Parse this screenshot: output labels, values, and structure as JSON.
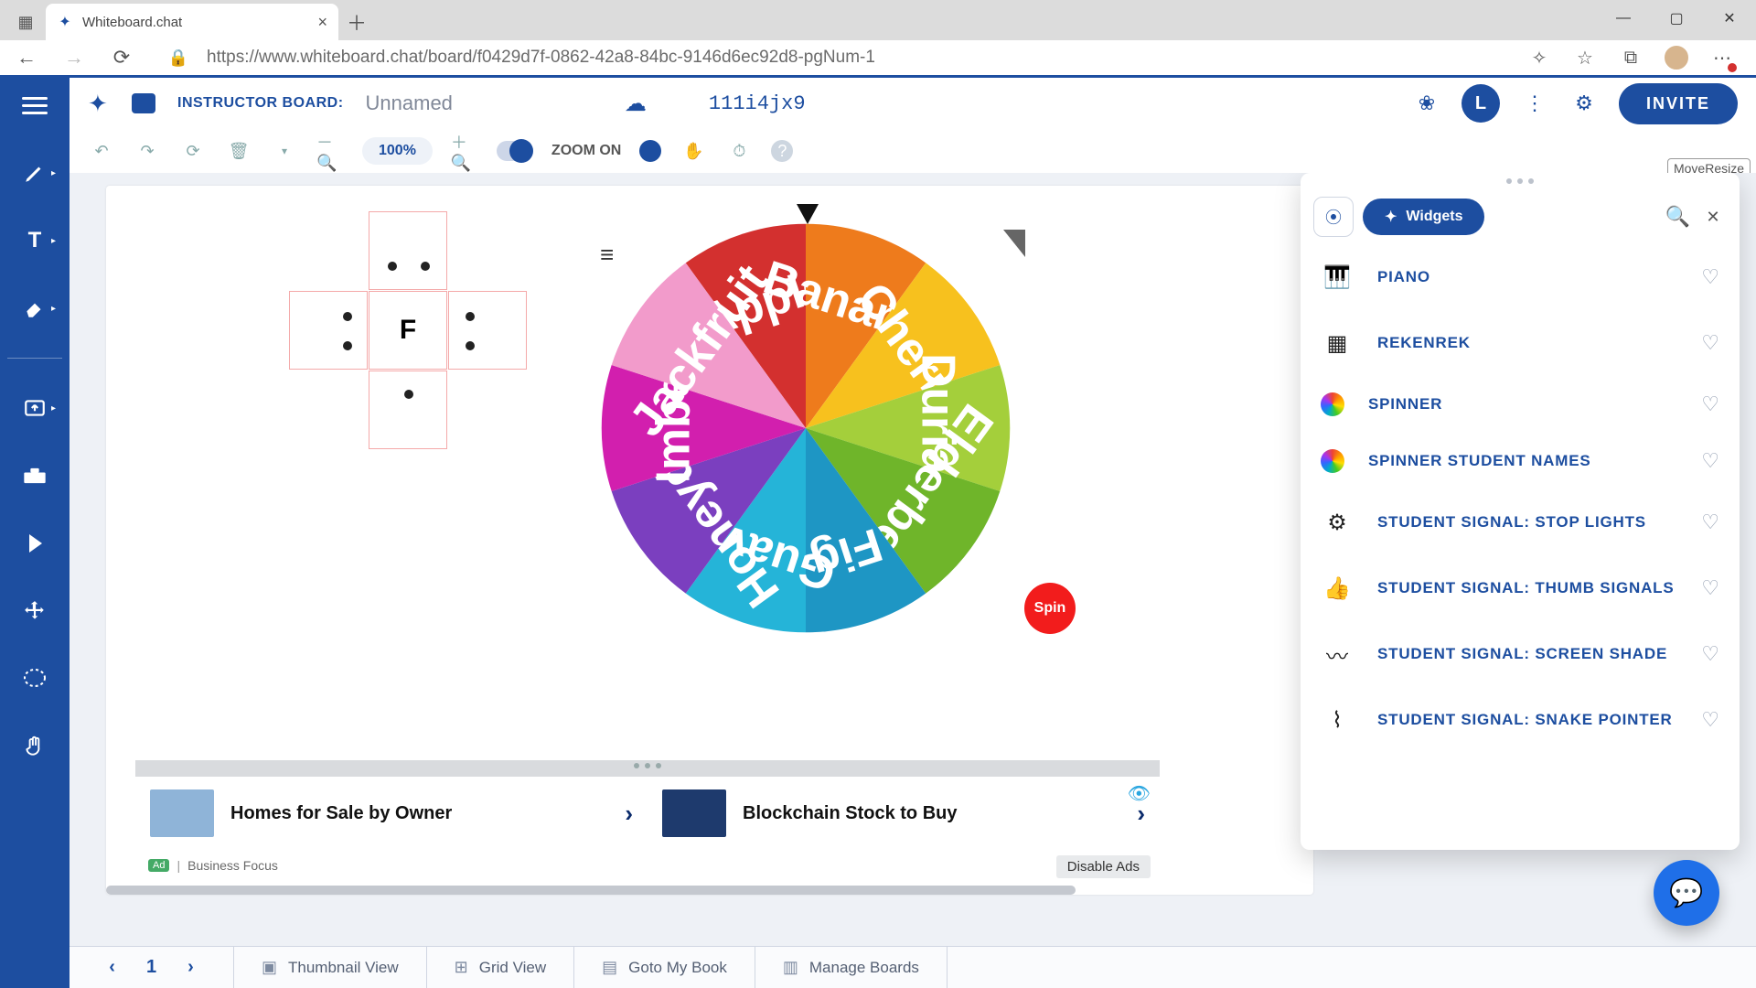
{
  "browser": {
    "tab_title": "Whiteboard.chat",
    "url": "https://www.whiteboard.chat/board/f0429d7f-0862-42a8-84bc-9146d6ec92d8-pgNum-1"
  },
  "header": {
    "board_label": "INSTRUCTOR BOARD:",
    "board_name": "Unnamed",
    "join_code": "111i4jx9",
    "avatar_initial": "L",
    "invite_label": "INVITE"
  },
  "toolbar": {
    "zoom_value": "100%",
    "zoom_toggle_label": "ZOOM ON",
    "move_resize_label": "MoveResize"
  },
  "sidebar_tools": [
    "pen",
    "text",
    "eraser",
    "upload",
    "toolbox",
    "play",
    "move",
    "lasso",
    "gesture"
  ],
  "spinner": {
    "segments": [
      {
        "label": "Apple",
        "color": "#d3302f"
      },
      {
        "label": "Banana",
        "color": "#ee7b1c"
      },
      {
        "label": "Cherry",
        "color": "#f7c11e"
      },
      {
        "label": "Durian",
        "color": "#a4cf3b"
      },
      {
        "label": "Elderberry",
        "color": "#6fb52a"
      },
      {
        "label": "Fig",
        "color": "#1e96c4"
      },
      {
        "label": "Guava",
        "color": "#25b4d8"
      },
      {
        "label": "Honeydew",
        "color": "#7b3fbf"
      },
      {
        "label": "Imbe",
        "color": "#d21fae"
      },
      {
        "label": "Jackfruit",
        "color": "#f29bcb"
      }
    ],
    "spin_label": "Spin"
  },
  "dice_letter": "F",
  "widgets": {
    "tab_label": "Widgets",
    "items": [
      {
        "label": "PIANO",
        "icon": "piano"
      },
      {
        "label": "REKENREK",
        "icon": "rekenrek"
      },
      {
        "label": "SPINNER",
        "icon": "rainbow"
      },
      {
        "label": "SPINNER STUDENT NAMES",
        "icon": "rainbow"
      },
      {
        "label": "STUDENT SIGNAL: STOP LIGHTS",
        "icon": "gear"
      },
      {
        "label": "STUDENT SIGNAL: THUMB SIGNALS",
        "icon": "thumb"
      },
      {
        "label": "STUDENT SIGNAL: SCREEN SHADE",
        "icon": "wave"
      },
      {
        "label": "STUDENT SIGNAL: SNAKE POINTER",
        "icon": "snake"
      }
    ]
  },
  "ads": {
    "cards": [
      {
        "title": "Homes for Sale by Owner"
      },
      {
        "title": "Blockchain Stock to Buy"
      }
    ],
    "provider_badge": "Ad",
    "provider_name": "Business Focus",
    "disable_label": "Disable Ads"
  },
  "bottom": {
    "page_number": "1",
    "buttons": [
      {
        "label": "Thumbnail View",
        "icon": "grid-thumb"
      },
      {
        "label": "Grid View",
        "icon": "grid"
      },
      {
        "label": "Goto My Book",
        "icon": "book"
      },
      {
        "label": "Manage Boards",
        "icon": "boards"
      }
    ]
  }
}
